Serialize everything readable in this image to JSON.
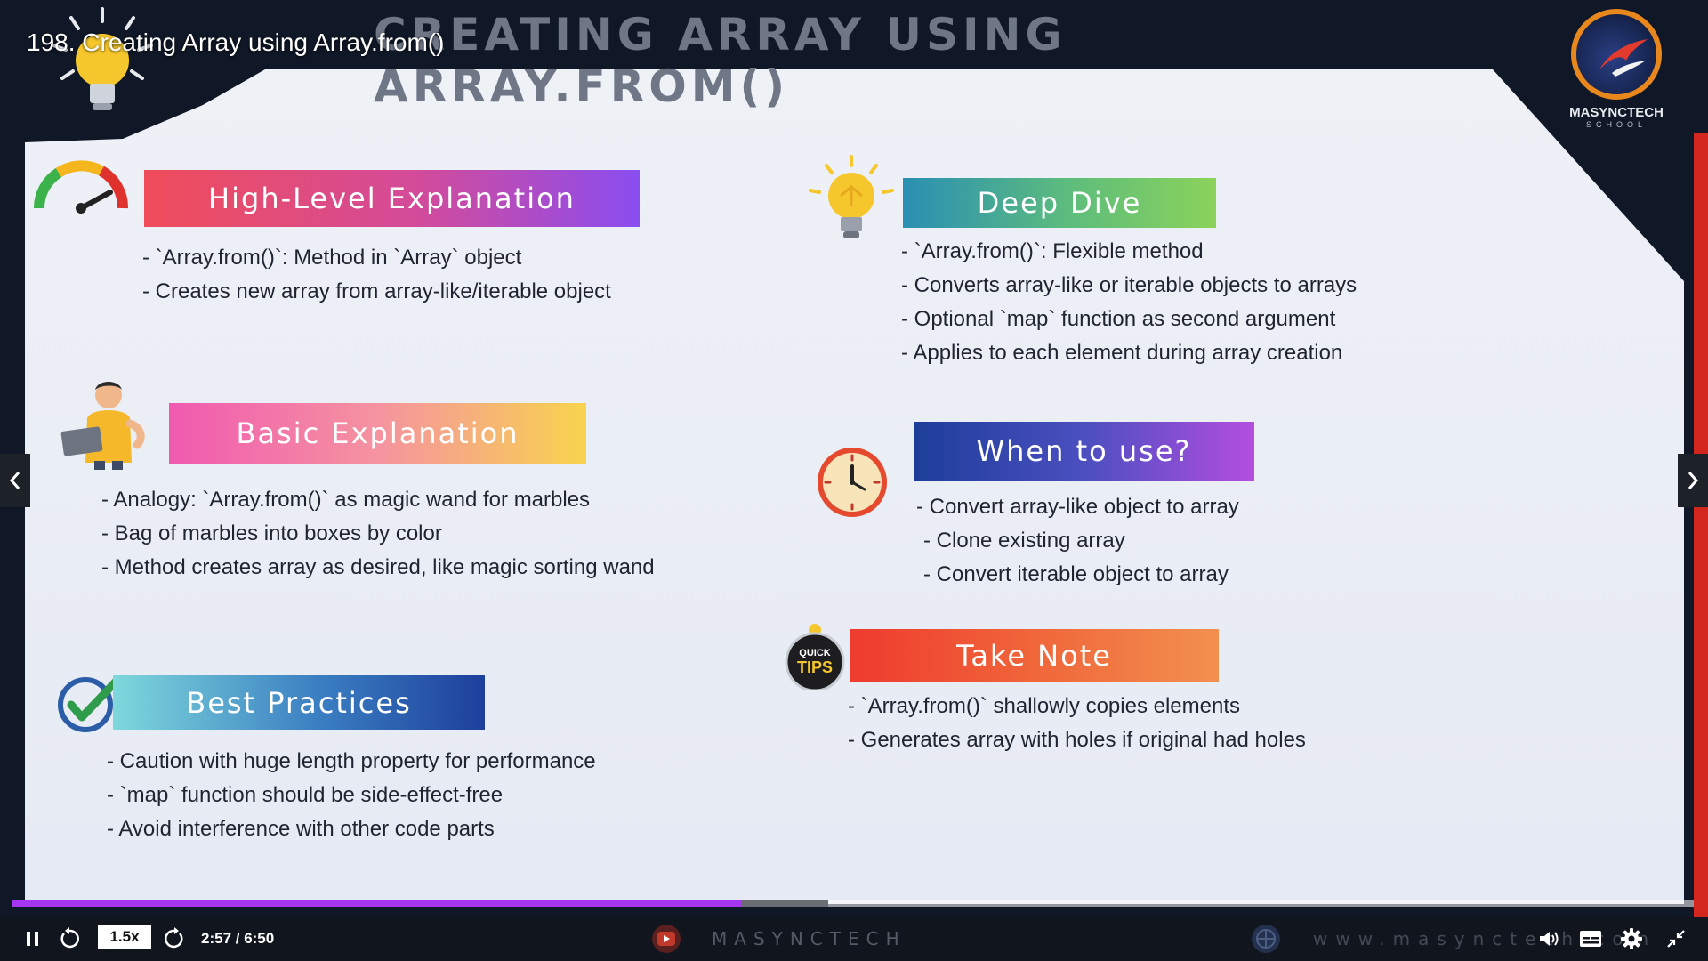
{
  "video": {
    "title": "198. Creating Array using Array.from()",
    "progress_fraction": 0.434,
    "buffer_fraction": 0.485
  },
  "slide": {
    "heading": "CREATING ARRAY USING ARRAY.FROM()",
    "brand": {
      "name": "MASYNCTECH",
      "tagline": "SCHOOL"
    },
    "sections": {
      "high_level": {
        "title": "High-Level Explanation",
        "icon": "gauge-icon",
        "bullets": [
          "- `Array.from()`: Method in `Array` object",
          "- Creates new array from array-like/iterable object"
        ]
      },
      "basic": {
        "title": "Basic Explanation",
        "icon": "person-laptop-icon",
        "bullets": [
          "- Analogy: `Array.from()` as magic wand for marbles",
          "- Bag of marbles into boxes by color",
          "- Method creates array as desired, like magic sorting wand"
        ]
      },
      "best_practices": {
        "title": "Best Practices",
        "icon": "checkmark-icon",
        "bullets": [
          "- Caution with huge length property for performance",
          "- `map` function should be side-effect-free",
          "- Avoid interference with other code parts"
        ]
      },
      "deep_dive": {
        "title": "Deep Dive",
        "icon": "lightbulb-icon",
        "bullets": [
          "- `Array.from()`: Flexible method",
          "- Converts array-like or iterable objects to arrays",
          "- Optional `map` function as second argument",
          "- Applies to each element during array creation"
        ]
      },
      "when_to_use": {
        "title": "When to use?",
        "icon": "clock-icon",
        "bullets": [
          "- Convert array-like object to array",
          "- Clone existing array",
          "- Convert iterable object to array"
        ]
      },
      "take_note": {
        "title": "Take Note",
        "icon": "quick-tips-icon",
        "icon_text": [
          "QUICK",
          "TIPS"
        ],
        "bullets": [
          "- `Array.from()` shallowly copies elements",
          "- Generates array with holes if original had holes"
        ]
      }
    }
  },
  "player": {
    "speed": "1.5x",
    "time": "2:57 / 6:50",
    "watermark_left": "MASYNCTECH",
    "watermark_right": "www.masynctech.com",
    "icons": {
      "pause": "pause-icon",
      "rewind": "rewind-icon",
      "forward": "forward-icon",
      "volume": "volume-icon",
      "captions": "captions-icon",
      "settings": "gear-icon",
      "fullscreen": "exit-fullscreen-icon",
      "prev": "chevron-left-icon",
      "next": "chevron-right-icon"
    }
  },
  "colors": {
    "progress_played": "#a435f0",
    "accent_red": "#d2261f"
  }
}
